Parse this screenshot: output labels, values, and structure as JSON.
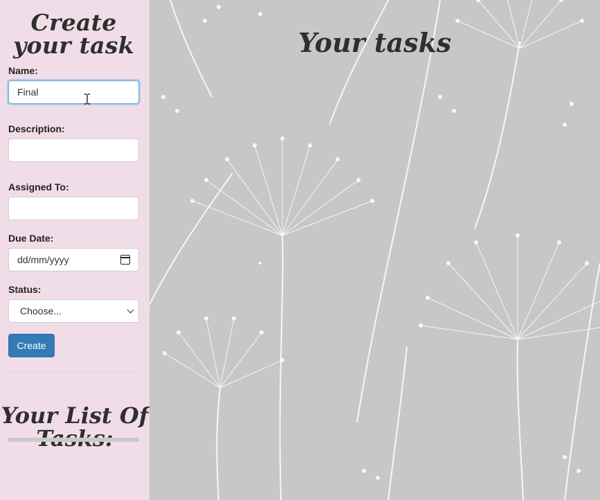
{
  "sidebar": {
    "title": "Create your task",
    "name_label": "Name:",
    "name_value": "Final",
    "description_label": "Description:",
    "description_value": "",
    "assigned_label": "Assigned To:",
    "assigned_value": "",
    "due_label": "Due Date:",
    "due_placeholder": "dd/mm/yyyy",
    "status_label": "Status:",
    "status_selected": "Choose...",
    "create_label": "Create",
    "list_title": "Your List Of Tasks:"
  },
  "main": {
    "title": "Your tasks"
  },
  "colors": {
    "sidebar_bg": "#f1dde8",
    "main_bg": "#c7c7c7",
    "button": "#337ab7",
    "title_text": "#2f2f2f"
  },
  "icons": {
    "date": "calendar-icon",
    "select": "chevron-down-icon",
    "cursor": "text-cursor-icon"
  }
}
